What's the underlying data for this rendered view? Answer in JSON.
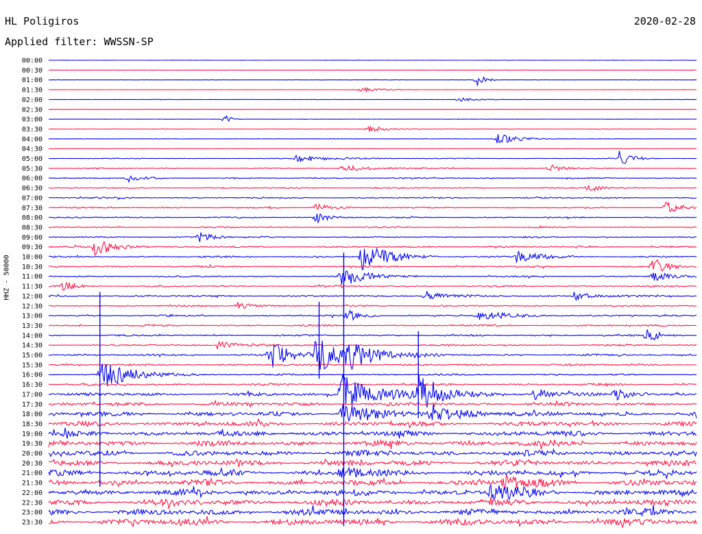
{
  "header": {
    "station": "HL Poligiros",
    "date": "2020-02-28",
    "filter": "Applied filter: WWSSN-SP"
  },
  "chart_data": {
    "type": "line",
    "title": "HL Poligiros",
    "subtitle": "Applied filter: WWSSN-SP",
    "ylabel": "HHZ - 50000",
    "xlabel": "",
    "grid": false,
    "legend": "none",
    "colors": [
      "#0000ee",
      "#ff1144"
    ],
    "rows": [
      "00:00",
      "00:30",
      "01:00",
      "01:30",
      "02:00",
      "02:30",
      "03:00",
      "03:30",
      "04:00",
      "04:30",
      "05:00",
      "05:30",
      "06:00",
      "06:30",
      "07:00",
      "07:30",
      "08:00",
      "08:30",
      "09:00",
      "09:30",
      "10:00",
      "10:30",
      "11:00",
      "11:30",
      "12:00",
      "12:30",
      "13:00",
      "13:30",
      "14:00",
      "14:30",
      "15:00",
      "15:30",
      "16:00",
      "16:30",
      "17:00",
      "17:30",
      "18:00",
      "18:30",
      "19:00",
      "19:30",
      "20:00",
      "20:30",
      "21:00",
      "21:30",
      "22:00",
      "22:30",
      "23:00",
      "23:30"
    ],
    "noise_level": [
      0.2,
      0.2,
      0.2,
      0.2,
      0.3,
      0.2,
      0.2,
      0.3,
      0.3,
      0.3,
      0.6,
      0.8,
      0.9,
      1.0,
      1.2,
      1.1,
      1.0,
      1.1,
      1.0,
      1.3,
      1.3,
      1.4,
      1.3,
      1.3,
      1.3,
      1.3,
      1.4,
      1.4,
      1.4,
      1.4,
      1.6,
      1.5,
      1.4,
      1.8,
      2.6,
      3.0,
      3.6,
      4.0,
      4.2,
      4.4,
      4.4,
      4.6,
      4.6,
      4.8,
      5.0,
      5.0,
      5.0,
      5.2
    ],
    "events": [
      {
        "row": 2,
        "x": 0.66,
        "amp": 12,
        "dur": 0.01
      },
      {
        "row": 3,
        "x": 0.48,
        "amp": 4,
        "dur": 0.03
      },
      {
        "row": 4,
        "x": 0.63,
        "amp": 4,
        "dur": 0.02
      },
      {
        "row": 6,
        "x": 0.27,
        "amp": 8,
        "dur": 0.01
      },
      {
        "row": 7,
        "x": 0.49,
        "amp": 5,
        "dur": 0.03
      },
      {
        "row": 8,
        "x": 0.69,
        "amp": 9,
        "dur": 0.03
      },
      {
        "row": 10,
        "x": 0.88,
        "amp": 10,
        "dur": 0.02
      },
      {
        "row": 10,
        "x": 0.38,
        "amp": 5,
        "dur": 0.05
      },
      {
        "row": 11,
        "x": 0.45,
        "amp": 5,
        "dur": 0.05
      },
      {
        "row": 11,
        "x": 0.77,
        "amp": 7,
        "dur": 0.02
      },
      {
        "row": 12,
        "x": 0.12,
        "amp": 6,
        "dur": 0.02
      },
      {
        "row": 13,
        "x": 0.83,
        "amp": 6,
        "dur": 0.02
      },
      {
        "row": 15,
        "x": 0.41,
        "amp": 8,
        "dur": 0.02
      },
      {
        "row": 15,
        "x": 0.95,
        "amp": 10,
        "dur": 0.02
      },
      {
        "row": 16,
        "x": 0.41,
        "amp": 9,
        "dur": 0.02
      },
      {
        "row": 18,
        "x": 0.23,
        "amp": 8,
        "dur": 0.02
      },
      {
        "row": 19,
        "x": 0.07,
        "amp": 14,
        "dur": 0.03
      },
      {
        "row": 20,
        "x": 0.48,
        "amp": 22,
        "dur": 0.04
      },
      {
        "row": 20,
        "x": 0.72,
        "amp": 10,
        "dur": 0.03
      },
      {
        "row": 21,
        "x": 0.93,
        "amp": 14,
        "dur": 0.02
      },
      {
        "row": 22,
        "x": 0.45,
        "amp": 14,
        "dur": 0.04
      },
      {
        "row": 22,
        "x": 0.93,
        "amp": 8,
        "dur": 0.02
      },
      {
        "row": 23,
        "x": 0.02,
        "amp": 8,
        "dur": 0.02
      },
      {
        "row": 24,
        "x": 0.58,
        "amp": 8,
        "dur": 0.03
      },
      {
        "row": 24,
        "x": 0.81,
        "amp": 6,
        "dur": 0.03
      },
      {
        "row": 25,
        "x": 0.29,
        "amp": 6,
        "dur": 0.02
      },
      {
        "row": 26,
        "x": 0.46,
        "amp": 9,
        "dur": 0.02
      },
      {
        "row": 26,
        "x": 0.66,
        "amp": 6,
        "dur": 0.05
      },
      {
        "row": 28,
        "x": 0.92,
        "amp": 10,
        "dur": 0.02
      },
      {
        "row": 29,
        "x": 0.26,
        "amp": 6,
        "dur": 0.03
      },
      {
        "row": 30,
        "x": 0.34,
        "amp": 22,
        "dur": 0.03
      },
      {
        "row": 30,
        "x": 0.41,
        "amp": 28,
        "dur": 0.04
      },
      {
        "row": 30,
        "x": 0.46,
        "amp": 16,
        "dur": 0.05
      },
      {
        "row": 32,
        "x": 0.08,
        "amp": 20,
        "dur": 0.05
      },
      {
        "row": 34,
        "x": 0.45,
        "amp": 30,
        "dur": 0.05
      },
      {
        "row": 34,
        "x": 0.57,
        "amp": 24,
        "dur": 0.04
      },
      {
        "row": 34,
        "x": 0.75,
        "amp": 10,
        "dur": 0.02
      },
      {
        "row": 34,
        "x": 0.87,
        "amp": 12,
        "dur": 0.02
      },
      {
        "row": 36,
        "x": 0.45,
        "amp": 16,
        "dur": 0.05
      },
      {
        "row": 36,
        "x": 0.59,
        "amp": 12,
        "dur": 0.05
      },
      {
        "row": 42,
        "x": 0.45,
        "amp": 10,
        "dur": 0.03
      },
      {
        "row": 43,
        "x": 0.7,
        "amp": 10,
        "dur": 0.04
      },
      {
        "row": 44,
        "x": 0.68,
        "amp": 12,
        "dur": 0.04
      }
    ],
    "spikes": [
      {
        "x": 0.079,
        "row_from": 24,
        "row_to": 43
      },
      {
        "x": 0.455,
        "row_from": 20,
        "row_to": 47
      },
      {
        "x": 0.417,
        "row_from": 25,
        "row_to": 32
      },
      {
        "x": 0.57,
        "row_from": 28,
        "row_to": 36
      }
    ]
  }
}
